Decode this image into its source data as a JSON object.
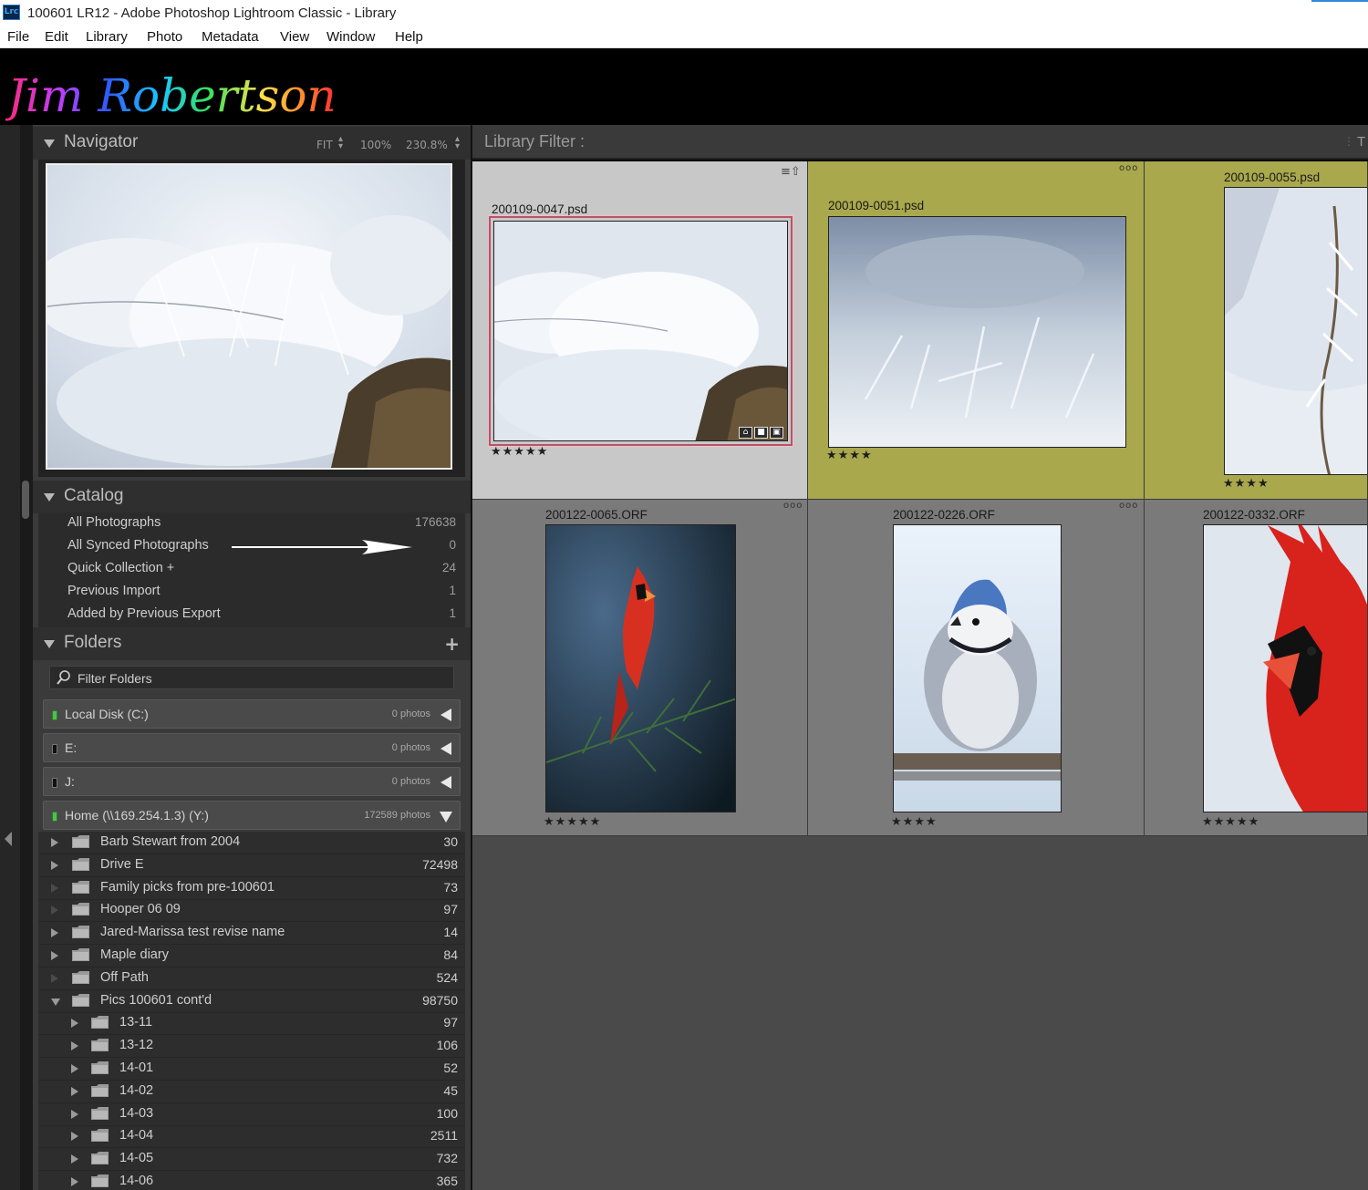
{
  "window": {
    "app_icon_text": "Lrc",
    "title": "100601 LR12 - Adobe Photoshop Lightroom Classic - Library"
  },
  "menu": [
    "File",
    "Edit",
    "Library",
    "Photo",
    "Metadata",
    "View",
    "Window",
    "Help"
  ],
  "identity_plate": {
    "text": "Jim Robertson"
  },
  "navigator": {
    "title": "Navigator",
    "zoom_fit": "FIT",
    "zoom_100": "100%",
    "zoom_custom": "230.8%"
  },
  "catalog": {
    "title": "Catalog",
    "items": [
      {
        "label": "All Photographs",
        "count": "176638"
      },
      {
        "label": "All Synced Photographs",
        "count": "0"
      },
      {
        "label": "Quick Collection  +",
        "count": "24"
      },
      {
        "label": "Previous Import",
        "count": "1"
      },
      {
        "label": "Added by Previous Export",
        "count": "1"
      }
    ]
  },
  "folders": {
    "title": "Folders",
    "add_button": "+",
    "filter_label": "Filter Folders",
    "volumes": [
      {
        "name": "Local Disk (C:)",
        "count": "0 photos",
        "led": "#4fbf4f"
      },
      {
        "name": "E:",
        "count": "0 photos",
        "led": "#111111"
      },
      {
        "name": "J:",
        "count": "0 photos",
        "led": "#111111"
      },
      {
        "name": "Home (\\\\169.254.1.3) (Y:)",
        "count": "172589 photos",
        "led": "#4fbf4f"
      }
    ],
    "items": [
      {
        "name": "Barb Stewart from 2004",
        "count": "30"
      },
      {
        "name": "Drive E",
        "count": "72498"
      },
      {
        "name": "Family picks from pre-100601",
        "count": "73"
      },
      {
        "name": "Hooper 06 09",
        "count": "97"
      },
      {
        "name": "Jared-Marissa test revise name",
        "count": "14"
      },
      {
        "name": "Maple diary",
        "count": "84"
      },
      {
        "name": "Off Path",
        "count": "524"
      },
      {
        "name": "Pics 100601 cont'd",
        "count": "98750"
      },
      {
        "name": "13-11",
        "count": "97"
      },
      {
        "name": "13-12",
        "count": "106"
      },
      {
        "name": "14-01",
        "count": "52"
      },
      {
        "name": "14-02",
        "count": "45"
      },
      {
        "name": "14-03",
        "count": "100"
      },
      {
        "name": "14-04",
        "count": "2511"
      },
      {
        "name": "14-05",
        "count": "732"
      },
      {
        "name": "14-06",
        "count": "365"
      }
    ]
  },
  "library_filter": {
    "title": "Library Filter :",
    "right_label": "T"
  },
  "grid": {
    "cells": [
      {
        "filename": "200109-0047.psd",
        "stars": "★★★★★",
        "label_color": "#c8c8c8",
        "selected": true
      },
      {
        "filename": "200109-0051.psd",
        "stars": "★★★★",
        "label_color": "#a9a84c",
        "selected": false
      },
      {
        "filename": "200109-0055.psd",
        "stars": "★★★★",
        "label_color": "#a9a84c",
        "selected": false
      },
      {
        "filename": "200122-0065.ORF",
        "stars": "★★★★★",
        "label_color": "#7a7a7a",
        "selected": false
      },
      {
        "filename": "200122-0226.ORF",
        "stars": "★★★★",
        "label_color": "#7a7a7a",
        "selected": false
      },
      {
        "filename": "200122-0332.ORF",
        "stars": "★★★★★",
        "label_color": "#7a7a7a",
        "selected": false
      }
    ],
    "cell_dots": "ooo"
  },
  "colors": {
    "panel_bg": "#3a3a3a",
    "grid_bg": "#4a4a4a",
    "yellow_label": "#a9a84c",
    "selected_cell": "#c8c8c8"
  }
}
